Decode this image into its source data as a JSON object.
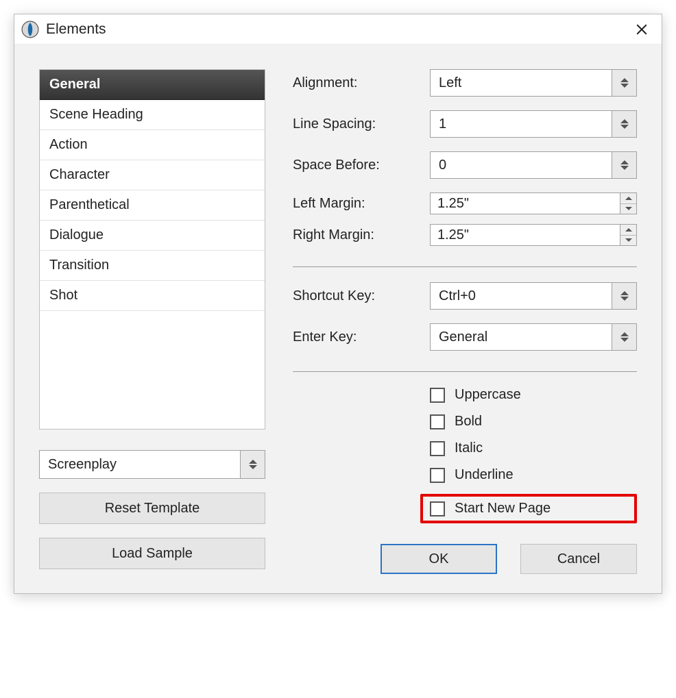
{
  "window": {
    "title": "Elements"
  },
  "sidebar": {
    "items": [
      {
        "label": "General",
        "selected": true
      },
      {
        "label": "Scene Heading",
        "selected": false
      },
      {
        "label": "Action",
        "selected": false
      },
      {
        "label": "Character",
        "selected": false
      },
      {
        "label": "Parenthetical",
        "selected": false
      },
      {
        "label": "Dialogue",
        "selected": false
      },
      {
        "label": "Transition",
        "selected": false
      },
      {
        "label": "Shot",
        "selected": false
      }
    ],
    "template_select": "Screenplay",
    "reset_template_label": "Reset Template",
    "load_sample_label": "Load Sample"
  },
  "settings": {
    "alignment": {
      "label": "Alignment:",
      "value": "Left"
    },
    "line_spacing": {
      "label": "Line Spacing:",
      "value": "1"
    },
    "space_before": {
      "label": "Space Before:",
      "value": "0"
    },
    "left_margin": {
      "label": "Left Margin:",
      "value": "1.25\""
    },
    "right_margin": {
      "label": "Right Margin:",
      "value": "1.25\""
    },
    "shortcut_key": {
      "label": "Shortcut Key:",
      "value": "Ctrl+0"
    },
    "enter_key": {
      "label": "Enter Key:",
      "value": "General"
    },
    "checks": {
      "uppercase": {
        "label": "Uppercase",
        "checked": false
      },
      "bold": {
        "label": "Bold",
        "checked": false
      },
      "italic": {
        "label": "Italic",
        "checked": false
      },
      "underline": {
        "label": "Underline",
        "checked": false
      },
      "start_new_page": {
        "label": "Start New Page",
        "checked": false,
        "highlighted": true
      }
    }
  },
  "footer": {
    "ok_label": "OK",
    "cancel_label": "Cancel"
  }
}
